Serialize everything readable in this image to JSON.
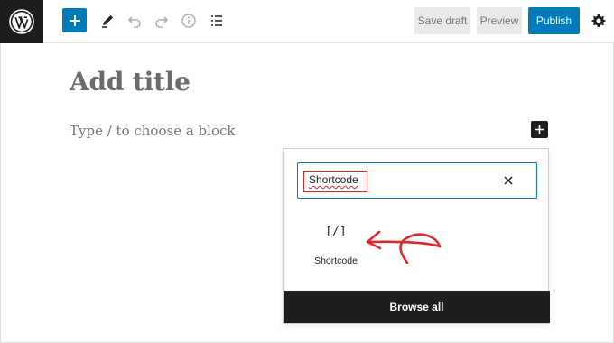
{
  "toolbar": {
    "save_draft_label": "Save draft",
    "preview_label": "Preview",
    "publish_label": "Publish",
    "accent_color": "#007cba"
  },
  "editor": {
    "title_placeholder": "Add title",
    "block_placeholder": "Type / to choose a block"
  },
  "inserter": {
    "search_value": "Shortcode",
    "result": {
      "icon_text": "[/]",
      "label": "Shortcode"
    },
    "browse_all_label": "Browse all",
    "annotation_color": "#e02626"
  },
  "icons": [
    "wordpress-logo",
    "plus-icon",
    "pen-icon",
    "undo-icon",
    "redo-icon",
    "info-icon",
    "list-view-icon",
    "gear-icon",
    "close-icon"
  ]
}
